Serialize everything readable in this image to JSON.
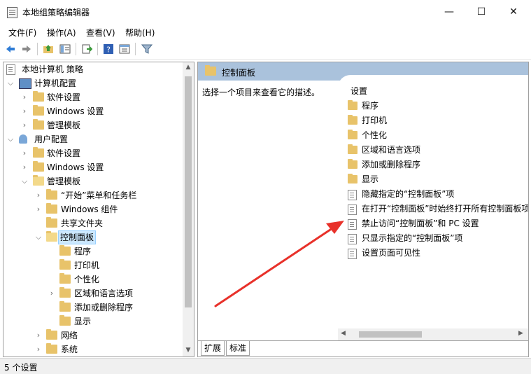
{
  "window": {
    "title": "本地组策略编辑器",
    "controls": {
      "minimize": "—",
      "maximize": "☐",
      "close": "✕"
    }
  },
  "menu": [
    "文件(F)",
    "操作(A)",
    "查看(V)",
    "帮助(H)"
  ],
  "toolbar": {
    "icons": [
      "back-arrow-icon",
      "forward-arrow-icon",
      "up-folder-icon",
      "show-hide-tree-icon",
      "export-list-icon",
      "help-icon",
      "properties-icon",
      "filter-icon"
    ]
  },
  "tree": {
    "root": "本地计算机 策略",
    "computer_config": "计算机配置",
    "computer_children": [
      "软件设置",
      "Windows 设置",
      "管理模板"
    ],
    "user_config": "用户配置",
    "user_children": [
      "软件设置",
      "Windows 设置",
      "管理模板"
    ],
    "admin_children": [
      "“开始”菜单和任务栏",
      "Windows 组件",
      "共享文件夹",
      "控制面板"
    ],
    "control_panel_children": [
      "程序",
      "打印机",
      "个性化",
      "区域和语言选项",
      "添加或删除程序",
      "显示"
    ],
    "after": [
      "网络",
      "系统"
    ]
  },
  "right": {
    "header": "控制面板",
    "description": "选择一个项目来查看它的描述。",
    "list_header": "设置",
    "folders": [
      "程序",
      "打印机",
      "个性化",
      "区域和语言选项",
      "添加或删除程序",
      "显示"
    ],
    "settings": [
      "隐藏指定的“控制面板”项",
      "在打开“控制面板”时始终打开所有控制面板项",
      "禁止访问“控制面板”和 PC 设置",
      "只显示指定的“控制面板”项",
      "设置页面可见性"
    ],
    "tabs": [
      "扩展",
      "标准"
    ]
  },
  "status": "5 个设置",
  "colors": {
    "header": "#aac2dc",
    "arrow": "#e8312a",
    "selection": "#cce8ff"
  }
}
